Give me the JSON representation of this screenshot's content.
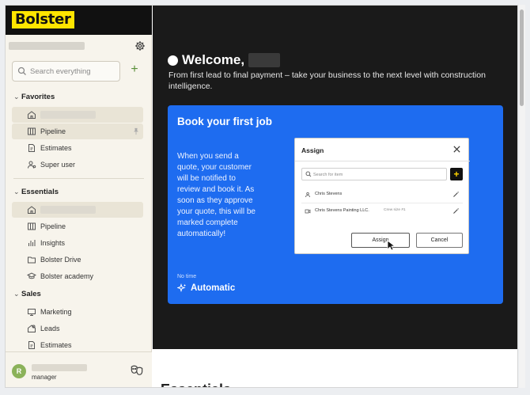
{
  "sidebar": {
    "logo": "Bolster",
    "search_placeholder": "Search everything",
    "sections": {
      "favorites": "Favorites",
      "essentials": "Essentials",
      "sales": "Sales"
    },
    "favorites": [
      "Pipeline",
      "Estimates",
      "Super user"
    ],
    "essentials": [
      "Pipeline",
      "Insights",
      "Bolster Drive",
      "Bolster academy"
    ],
    "sales": [
      "Marketing",
      "Leads",
      "Estimates"
    ],
    "footer": {
      "avatar_initial": "R",
      "role": "manager"
    }
  },
  "hero": {
    "welcome": "Welcome,",
    "subtitle": "From first lead to final payment – take your business to the next level with construction intelligence."
  },
  "card": {
    "title": "Book your first job",
    "body": "When you send a quote, your customer will be notified to review and book it. As soon as they approve your quote, this will be marked complete automatically!",
    "meta": "No time",
    "tag": "Automatic"
  },
  "dialog": {
    "title": "Assign",
    "search_placeholder": "Search for item",
    "add_label": "+",
    "rows": [
      {
        "name": "Chris Stevens",
        "extra": ""
      },
      {
        "name": "Chris Stevens Painting LLC.",
        "extra": "Crew size #1"
      }
    ],
    "assign_label": "Assign",
    "cancel_label": "Cancel"
  },
  "main": {
    "section_heading": "Essentials"
  }
}
